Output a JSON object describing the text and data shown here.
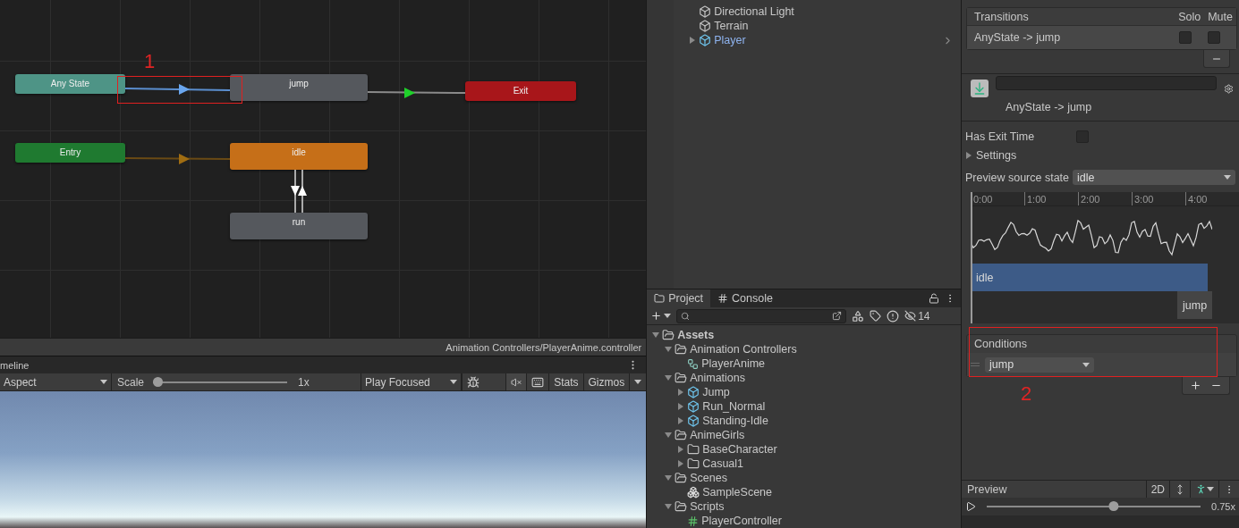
{
  "animator": {
    "states": [
      {
        "name": "Any State",
        "kind": "any"
      },
      {
        "name": "jump",
        "kind": "state"
      },
      {
        "name": "Exit",
        "kind": "exit"
      },
      {
        "name": "Entry",
        "kind": "entry"
      },
      {
        "name": "idle",
        "kind": "default"
      },
      {
        "name": "run",
        "kind": "state"
      }
    ],
    "annotation": "1",
    "path": "Animation Controllers/PlayerAnime.controller"
  },
  "game_view": {
    "tab": "meline",
    "aspect": "Aspect",
    "scale_label": "Scale",
    "scale": {
      "level": 0,
      "reading": "1x"
    },
    "play_mode": "Play Focused",
    "stats": "Stats",
    "gizmos": "Gizmos"
  },
  "hierarchy": {
    "items": [
      {
        "name": "Directional Light",
        "kind": "object"
      },
      {
        "name": "Terrain",
        "kind": "object"
      },
      {
        "name": "Player",
        "kind": "prefab",
        "expanded": false
      }
    ]
  },
  "project": {
    "tabs": [
      {
        "label": "Project",
        "selected": true
      },
      {
        "label": "Console",
        "selected": false
      }
    ],
    "hidden_count": "14",
    "tree": [
      {
        "name": "Assets",
        "kind": "folder",
        "expanded": true,
        "children": [
          {
            "name": "Animation Controllers",
            "kind": "folder",
            "expanded": true,
            "children": [
              {
                "name": "PlayerAnime",
                "kind": "controller"
              }
            ]
          },
          {
            "name": "Animations",
            "kind": "folder",
            "expanded": true,
            "children": [
              {
                "name": "Jump",
                "kind": "model",
                "expanded": false
              },
              {
                "name": "Run_Normal",
                "kind": "model",
                "expanded": false
              },
              {
                "name": "Standing-Idle",
                "kind": "model",
                "expanded": false
              }
            ]
          },
          {
            "name": "AnimeGirls",
            "kind": "folder",
            "expanded": true,
            "children": [
              {
                "name": "BaseCharacter",
                "kind": "folder",
                "expanded": false
              },
              {
                "name": "Casual1",
                "kind": "folder",
                "expanded": false
              }
            ]
          },
          {
            "name": "Scenes",
            "kind": "folder",
            "expanded": true,
            "children": [
              {
                "name": "SampleScene",
                "kind": "scene"
              }
            ]
          },
          {
            "name": "Scripts",
            "kind": "folder",
            "expanded": true,
            "children": [
              {
                "name": "PlayerController",
                "kind": "script"
              }
            ]
          }
        ]
      }
    ]
  },
  "inspector": {
    "transitions": {
      "header": "Transitions",
      "solo_label": "Solo",
      "mute_label": "Mute",
      "rows": [
        {
          "name": "AnyState -> jump",
          "solo": false,
          "mute": false
        }
      ]
    },
    "title": "AnyState -> jump",
    "has_exit_time": {
      "label": "Has Exit Time",
      "checked": false
    },
    "settings": {
      "label": "Settings",
      "expanded": false
    },
    "preview_source": {
      "label": "Preview source state",
      "value": "idle"
    },
    "timeline": {
      "ticks": [
        "0:00",
        "1:00",
        "2:00",
        "3:00",
        "4:00"
      ],
      "tracks": [
        "idle",
        "jump"
      ]
    },
    "conditions": {
      "header": "Conditions",
      "items": [
        {
          "parameter": "jump"
        }
      ]
    },
    "annotation": "2",
    "preview": {
      "label": "Preview",
      "mode": "2D",
      "speed": {
        "level": 0.6,
        "reading": "0.75x"
      }
    }
  }
}
